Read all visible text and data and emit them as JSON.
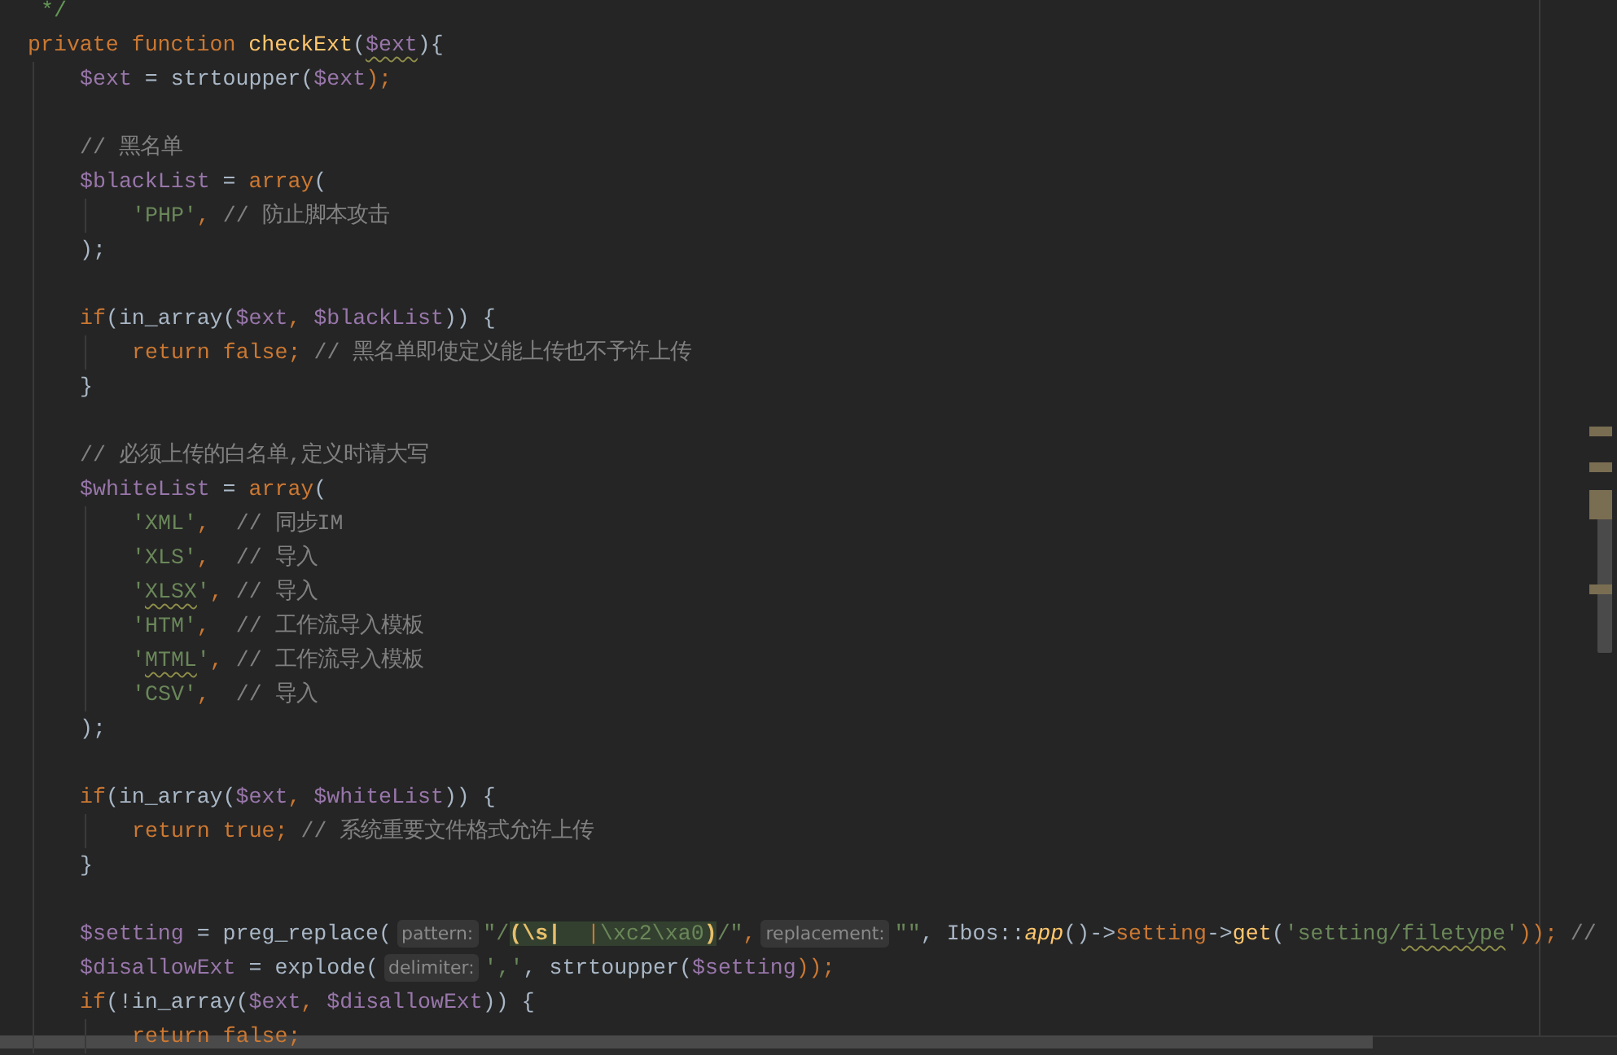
{
  "editor": {
    "lines": [
      {
        "kind": "code",
        "tokens": [
          {
            "t": "*/",
            "kind": "doc"
          }
        ]
      },
      {
        "kind": "code",
        "tokens": [
          {
            "t": "private function ",
            "kind": "kw"
          },
          {
            "t": "checkExt",
            "kind": "fn"
          },
          {
            "t": "(",
            "kind": "plain"
          },
          {
            "t": "$ext",
            "kind": "var",
            "warn": true
          },
          {
            "t": "){",
            "kind": "plain"
          }
        ],
        "children": [
          {
            "kind": "code",
            "tokens": [
              {
                "t": "$ext",
                "kind": "var"
              },
              {
                "t": " = strtoupper(",
                "kind": "plain"
              },
              {
                "t": "$ext",
                "kind": "var"
              },
              {
                "t": ");",
                "kind": "kw"
              }
            ]
          },
          {
            "kind": "blank"
          },
          {
            "kind": "code",
            "tokens": [
              {
                "t": "// 黑名单",
                "kind": "cm"
              }
            ]
          },
          {
            "kind": "code",
            "tokens": [
              {
                "t": "$blackList",
                "kind": "var"
              },
              {
                "t": " = ",
                "kind": "plain"
              },
              {
                "t": "array",
                "kind": "kw"
              },
              {
                "t": "(",
                "kind": "plain"
              }
            ],
            "children": [
              {
                "kind": "code",
                "tokens": [
                  {
                    "t": "'PHP'",
                    "kind": "str"
                  },
                  {
                    "t": ", ",
                    "kind": "kw"
                  },
                  {
                    "t": "// 防止脚本攻击",
                    "kind": "cm"
                  }
                ]
              }
            ]
          },
          {
            "kind": "code",
            "tokens": [
              {
                "t": ");",
                "kind": "plain"
              }
            ]
          },
          {
            "kind": "blank"
          },
          {
            "kind": "code",
            "tokens": [
              {
                "t": "if",
                "kind": "kw"
              },
              {
                "t": "(in_array(",
                "kind": "plain"
              },
              {
                "t": "$ext",
                "kind": "var"
              },
              {
                "t": ", ",
                "kind": "kw"
              },
              {
                "t": "$blackList",
                "kind": "var"
              },
              {
                "t": ")) {",
                "kind": "plain"
              }
            ],
            "children": [
              {
                "kind": "code",
                "tokens": [
                  {
                    "t": "return false; ",
                    "kind": "kw"
                  },
                  {
                    "t": "// 黑名单即使定义能上传也不予许上传",
                    "kind": "cm"
                  }
                ]
              }
            ]
          },
          {
            "kind": "code",
            "tokens": [
              {
                "t": "}",
                "kind": "plain"
              }
            ]
          },
          {
            "kind": "blank"
          },
          {
            "kind": "code",
            "tokens": [
              {
                "t": "// 必须上传的白名单,定义时请大写",
                "kind": "cm"
              }
            ]
          },
          {
            "kind": "code",
            "tokens": [
              {
                "t": "$whiteList",
                "kind": "var"
              },
              {
                "t": " = ",
                "kind": "plain"
              },
              {
                "t": "array",
                "kind": "kw"
              },
              {
                "t": "(",
                "kind": "plain"
              }
            ],
            "children": [
              {
                "kind": "code",
                "tokens": [
                  {
                    "t": "'XML'",
                    "kind": "str"
                  },
                  {
                    "t": ",  ",
                    "kind": "kw"
                  },
                  {
                    "t": "// 同步IM",
                    "kind": "cm"
                  }
                ]
              },
              {
                "kind": "code",
                "tokens": [
                  {
                    "t": "'XLS'",
                    "kind": "str"
                  },
                  {
                    "t": ",  ",
                    "kind": "kw"
                  },
                  {
                    "t": "// 导入",
                    "kind": "cm"
                  }
                ]
              },
              {
                "kind": "code",
                "tokens": [
                  {
                    "t": "'",
                    "kind": "str"
                  },
                  {
                    "t": "XLSX",
                    "kind": "str",
                    "warn": true
                  },
                  {
                    "t": "'",
                    "kind": "str"
                  },
                  {
                    "t": ", ",
                    "kind": "kw"
                  },
                  {
                    "t": "// 导入",
                    "kind": "cm"
                  }
                ]
              },
              {
                "kind": "code",
                "tokens": [
                  {
                    "t": "'HTM'",
                    "kind": "str"
                  },
                  {
                    "t": ",  ",
                    "kind": "kw"
                  },
                  {
                    "t": "// 工作流导入模板",
                    "kind": "cm"
                  }
                ]
              },
              {
                "kind": "code",
                "tokens": [
                  {
                    "t": "'",
                    "kind": "str"
                  },
                  {
                    "t": "MTML",
                    "kind": "str",
                    "warn": true
                  },
                  {
                    "t": "'",
                    "kind": "str"
                  },
                  {
                    "t": ", ",
                    "kind": "kw"
                  },
                  {
                    "t": "// 工作流导入模板",
                    "kind": "cm"
                  }
                ]
              },
              {
                "kind": "code",
                "tokens": [
                  {
                    "t": "'CSV'",
                    "kind": "str"
                  },
                  {
                    "t": ",  ",
                    "kind": "kw"
                  },
                  {
                    "t": "// 导入",
                    "kind": "cm"
                  }
                ]
              }
            ]
          },
          {
            "kind": "code",
            "tokens": [
              {
                "t": ");",
                "kind": "plain"
              }
            ]
          },
          {
            "kind": "blank"
          },
          {
            "kind": "code",
            "tokens": [
              {
                "t": "if",
                "kind": "kw"
              },
              {
                "t": "(in_array(",
                "kind": "plain"
              },
              {
                "t": "$ext",
                "kind": "var"
              },
              {
                "t": ", ",
                "kind": "kw"
              },
              {
                "t": "$whiteList",
                "kind": "var"
              },
              {
                "t": ")) {",
                "kind": "plain"
              }
            ],
            "children": [
              {
                "kind": "code",
                "tokens": [
                  {
                    "t": "return true; ",
                    "kind": "kw"
                  },
                  {
                    "t": "// 系统重要文件格式允许上传",
                    "kind": "cm"
                  }
                ]
              }
            ]
          },
          {
            "kind": "code",
            "tokens": [
              {
                "t": "}",
                "kind": "plain"
              }
            ]
          },
          {
            "kind": "blank"
          },
          {
            "kind": "code",
            "tokens": [
              {
                "t": "$setting",
                "kind": "var"
              },
              {
                "t": " = preg_replace(",
                "kind": "plain"
              },
              {
                "t": "pattern:",
                "kind": "hint"
              },
              {
                "t": "\"/",
                "kind": "str"
              },
              {
                "t": "(\\s|",
                "kind": "regrp"
              },
              {
                "t": "  |",
                "kind": "reop"
              },
              {
                "t": "\\xc2\\xa0",
                "kind": "restr"
              },
              {
                "t": ")",
                "kind": "regrp"
              },
              {
                "t": "/\"",
                "kind": "str"
              },
              {
                "t": ",",
                "kind": "kw"
              },
              {
                "t": "replacement:",
                "kind": "hint"
              },
              {
                "t": "\"\"",
                "kind": "str"
              },
              {
                "t": ", Ibos::",
                "kind": "plain"
              },
              {
                "t": "app",
                "kind": "static"
              },
              {
                "t": "()->",
                "kind": "plain"
              },
              {
                "t": "setting",
                "kind": "field"
              },
              {
                "t": "->",
                "kind": "plain"
              },
              {
                "t": "get",
                "kind": "fn"
              },
              {
                "t": "(",
                "kind": "plain"
              },
              {
                "t": "'setting/",
                "kind": "str"
              },
              {
                "t": "filetype",
                "kind": "str",
                "warn": true
              },
              {
                "t": "'",
                "kind": "str"
              },
              {
                "t": ")); ",
                "kind": "kw"
              },
              {
                "t": "//",
                "kind": "cm"
              }
            ]
          },
          {
            "kind": "code",
            "tokens": [
              {
                "t": "$disallowExt",
                "kind": "var"
              },
              {
                "t": " = explode(",
                "kind": "plain"
              },
              {
                "t": "delimiter:",
                "kind": "hint"
              },
              {
                "t": "','",
                "kind": "str"
              },
              {
                "t": ", strtoupper(",
                "kind": "plain"
              },
              {
                "t": "$setting",
                "kind": "var"
              },
              {
                "t": "));",
                "kind": "kw"
              }
            ]
          },
          {
            "kind": "code",
            "tokens": [
              {
                "t": "if",
                "kind": "kw"
              },
              {
                "t": "(!in_array(",
                "kind": "plain"
              },
              {
                "t": "$ext",
                "kind": "var"
              },
              {
                "t": ", ",
                "kind": "kw"
              },
              {
                "t": "$disallowExt",
                "kind": "var"
              },
              {
                "t": ")) {",
                "kind": "plain"
              }
            ],
            "children": [
              {
                "kind": "code",
                "tokens": [
                  {
                    "t": "return false;",
                    "kind": "kw"
                  }
                ]
              }
            ]
          }
        ]
      }
    ]
  }
}
